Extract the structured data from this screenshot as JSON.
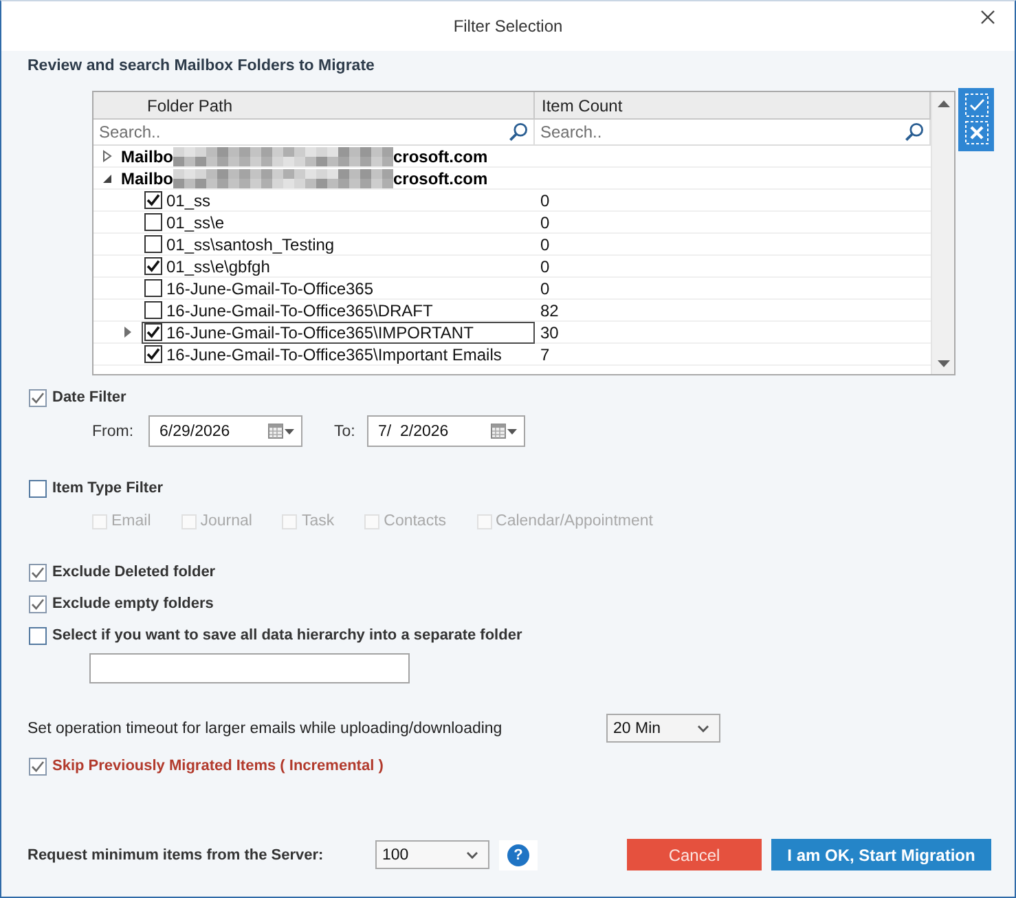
{
  "window": {
    "title": "Filter Selection"
  },
  "heading": "Review and search Mailbox Folders to Migrate",
  "folder_grid": {
    "columns": [
      {
        "label": "Folder Path",
        "search_placeholder": "Search.."
      },
      {
        "label": "Item Count",
        "search_placeholder": "Search.."
      }
    ],
    "mailboxes": [
      {
        "name_start": "Mailbo",
        "name_end": "crosoft.com",
        "expanded": false
      },
      {
        "name_start": "Mailbo",
        "name_end": "crosoft.com",
        "expanded": true,
        "children": [
          {
            "name": "01_ss",
            "count": "0",
            "checked": true,
            "expandable": false,
            "selected": false
          },
          {
            "name": "01_ss\\e",
            "count": "0",
            "checked": false,
            "expandable": false,
            "selected": false
          },
          {
            "name": "01_ss\\santosh_Testing",
            "count": "0",
            "checked": false,
            "expandable": false,
            "selected": false
          },
          {
            "name": "01_ss\\e\\gbfgh",
            "count": "0",
            "checked": true,
            "expandable": false,
            "selected": false
          },
          {
            "name": "16-June-Gmail-To-Office365",
            "count": "0",
            "checked": false,
            "expandable": false,
            "selected": false
          },
          {
            "name": "16-June-Gmail-To-Office365\\DRAFT",
            "count": "82",
            "checked": false,
            "expandable": false,
            "selected": false
          },
          {
            "name": "16-June-Gmail-To-Office365\\IMPORTANT",
            "count": "30",
            "checked": true,
            "expandable": true,
            "selected": true
          },
          {
            "name": "16-June-Gmail-To-Office365\\Important Emails",
            "count": "7",
            "checked": true,
            "expandable": false,
            "selected": false
          }
        ]
      }
    ]
  },
  "date_filter": {
    "label": "Date Filter",
    "checked": true,
    "from_label": "From:",
    "from": "6/29/2026",
    "to_label": "To:",
    "to": "7/  2/2026"
  },
  "item_type_filter": {
    "label": "Item Type Filter",
    "checked": false,
    "types": [
      {
        "label": "Email",
        "checked": false,
        "disabled": true
      },
      {
        "label": "Journal",
        "checked": false,
        "disabled": true
      },
      {
        "label": "Task",
        "checked": false,
        "disabled": true
      },
      {
        "label": "Contacts",
        "checked": false,
        "disabled": true
      },
      {
        "label": "Calendar/Appointment",
        "checked": false,
        "disabled": true
      }
    ]
  },
  "options": [
    {
      "label": "Exclude Deleted folder",
      "checked": true
    },
    {
      "label": "Exclude empty folders",
      "checked": true
    },
    {
      "label": "Select if you want to save all data hierarchy into a separate folder",
      "checked": false
    }
  ],
  "timeout": {
    "label": "Set operation timeout for larger emails while uploading/downloading",
    "value": "20 Min"
  },
  "incremental": {
    "label": "Skip Previously Migrated Items ( Incremental )",
    "checked": true
  },
  "request_minimum": {
    "label": "Request minimum items from the Server:",
    "value": "100",
    "help": "?"
  },
  "buttons": [
    {
      "label": "Cancel",
      "kind": "cancel"
    },
    {
      "label": "I am OK, Start Migration",
      "kind": "primary"
    }
  ]
}
